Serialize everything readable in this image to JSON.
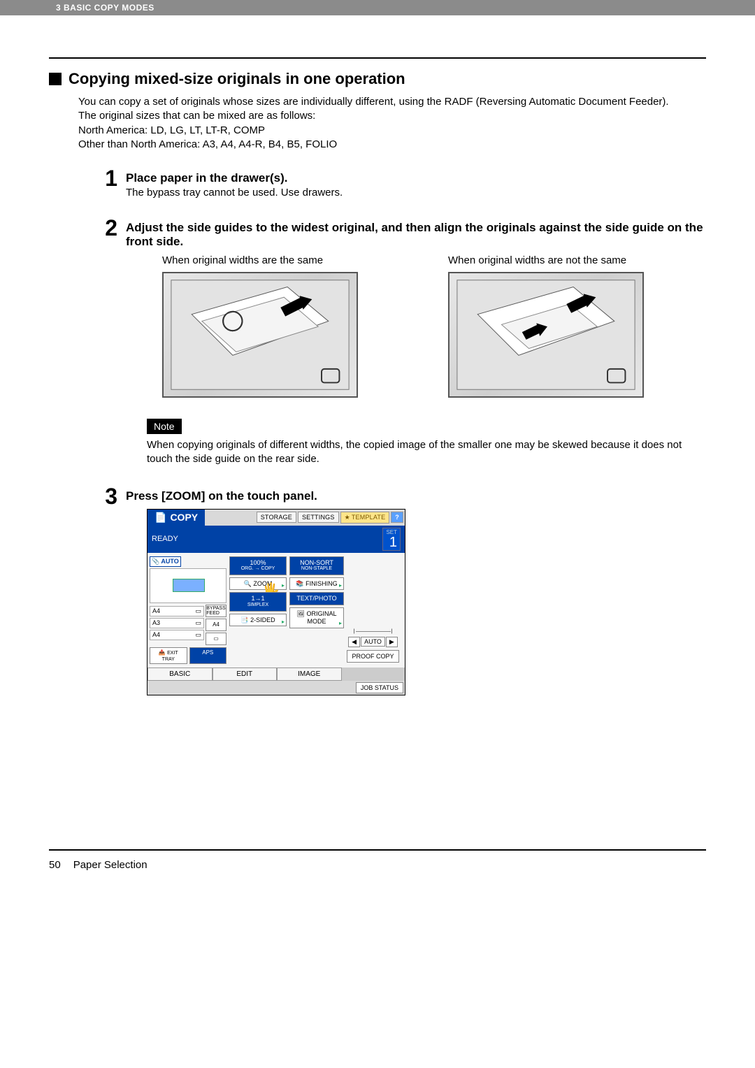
{
  "header": "3 BASIC COPY MODES",
  "sectionTitle": "Copying mixed-size originals in one operation",
  "intro": [
    "You can copy a set of originals whose sizes are individually different, using the RADF (Reversing Automatic Document Feeder).",
    "The original sizes that can be mixed are as follows:",
    "North America: LD, LG, LT, LT-R, COMP",
    "Other than North America: A3, A4, A4-R, B4, B5, FOLIO"
  ],
  "steps": [
    {
      "num": "1",
      "title": "Place paper in the drawer(s).",
      "desc": "The bypass tray cannot be used. Use drawers."
    },
    {
      "num": "2",
      "title": "Adjust the side guides to the widest original, and then align the originals against the side guide on the front side.",
      "col1Label": "When original widths are the same",
      "col2Label": "When original widths are not the same"
    },
    {
      "num": "3",
      "title": "Press [ZOOM] on the touch panel."
    }
  ],
  "note": {
    "tag": "Note",
    "text": "When copying originals of different widths, the copied image of the smaller one may be skewed because it does not touch the side guide on the rear side."
  },
  "panel": {
    "copy": "COPY",
    "tabs": {
      "storage": "STORAGE",
      "settings": "SETTINGS",
      "template": "TEMPLATE",
      "help": "?"
    },
    "ready": "READY",
    "set": {
      "label": "SET",
      "value": "1"
    },
    "auto": "AUTO",
    "bypass": "BYPASS FEED",
    "trays": [
      "A4",
      "A3",
      "A4"
    ],
    "stack": [
      "A4",
      ""
    ],
    "exitTray": "EXIT TRAY",
    "aps": "APS",
    "mid": {
      "ratioTop": "100%",
      "ratioSub": "ORG. → COPY",
      "zoom": "ZOOM",
      "simplexTop": "1→1",
      "simplexSub": "SIMPLEX",
      "twoSided": "2-SIDED"
    },
    "right": {
      "nonsort1": "NON-SORT",
      "nonsort2": "NON-STAPLE",
      "finishing": "FINISHING",
      "textphoto": "TEXT/PHOTO",
      "originalmode": "ORIGINAL MODE"
    },
    "far": {
      "left": "◀",
      "auto": "AUTO",
      "right": "▶",
      "proof": "PROOF COPY"
    },
    "bottomTabs": [
      "BASIC",
      "EDIT",
      "IMAGE"
    ],
    "jobstatus": "JOB STATUS"
  },
  "footer": {
    "page": "50",
    "title": "Paper Selection"
  }
}
